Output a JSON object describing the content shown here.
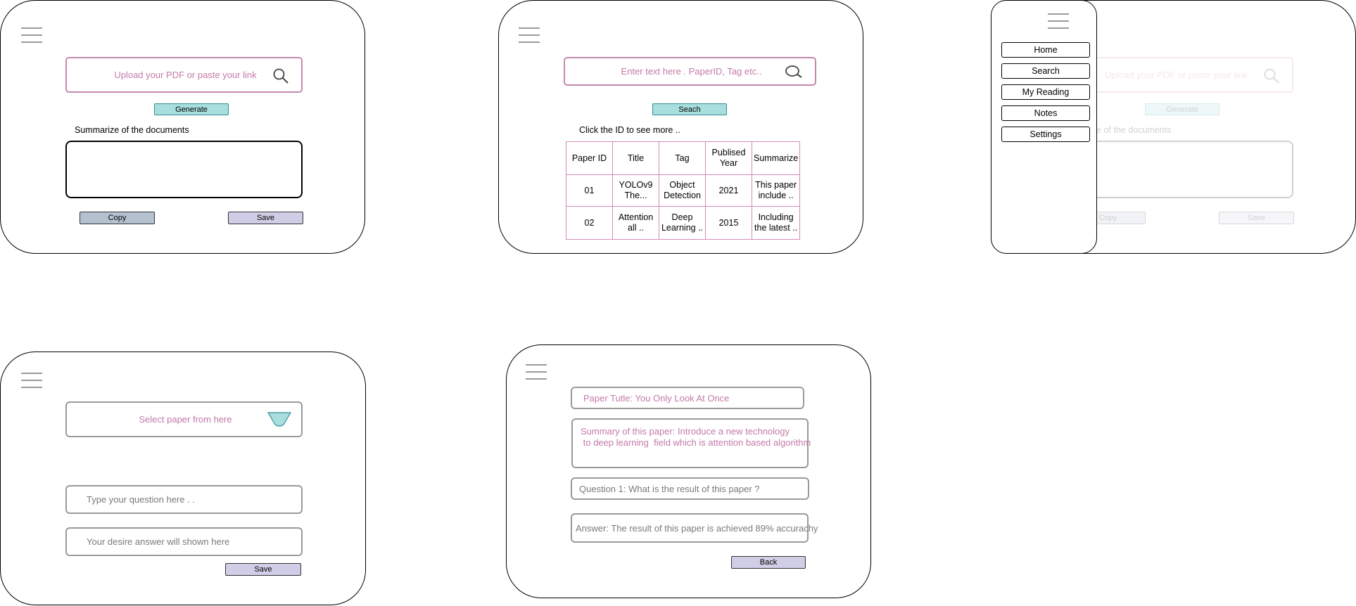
{
  "frame1": {
    "upload_placeholder": "Upload your PDF or paste your link",
    "generate_label": "Generate",
    "summary_label": "Summarize of the documents",
    "summary_value": "",
    "copy_label": "Copy",
    "save_label": "Save"
  },
  "frame2": {
    "search_placeholder": "Enter text here . PaperID, Tag etc..",
    "search_label": "Seach",
    "hint": "Click the ID to see more ..",
    "columns": [
      "Paper ID",
      "Title",
      "Tag",
      "Publised Year",
      "Summarize"
    ],
    "rows": [
      {
        "id": "01",
        "title": "YOLOv9 The...",
        "tag": "Object Detection",
        "year": "2021",
        "summary": "This paper include .."
      },
      {
        "id": "02",
        "title": "Attention all ..",
        "tag": "Deep Learning ..",
        "year": "2015",
        "summary": "Including the latest .."
      }
    ]
  },
  "frame3": {
    "menu_items": [
      "Home",
      "Search",
      "My Reading",
      "Notes",
      "Settings"
    ],
    "bg_upload_placeholder": "Upload your PDF or paste your link",
    "bg_generate_label": "Generate",
    "bg_summary_label": "ize of the documents",
    "bg_copy_label": "Copy",
    "bg_save_label": "Save"
  },
  "frame4": {
    "select_placeholder": "Select paper from here",
    "question_placeholder": "Type your question here . .",
    "answer_placeholder": "Your desire answer will shown here",
    "save_label": "Save"
  },
  "frame5": {
    "paper_title": "Paper Tutle: You Only Look At Once",
    "summary_line1": "Summary of this paper: Introduce a new technology",
    "summary_line2": " to deep learning  field which is attention based algorithm",
    "question": "Question 1: What is the result of this paper ?",
    "answer": "Answer: The result of this paper is achieved 89% accurachy",
    "back_label": "Back"
  },
  "colors": {
    "pink_border": "#c48aae",
    "pink_text": "#c47aa8",
    "teal_button": "#a8dede",
    "lavender_button": "#d0cde6",
    "gray_button": "#b4c2cf",
    "table_border": "#d48cb6"
  },
  "icons": [
    "hamburger-menu-icon",
    "search-icon",
    "dropdown-triangle-icon"
  ]
}
